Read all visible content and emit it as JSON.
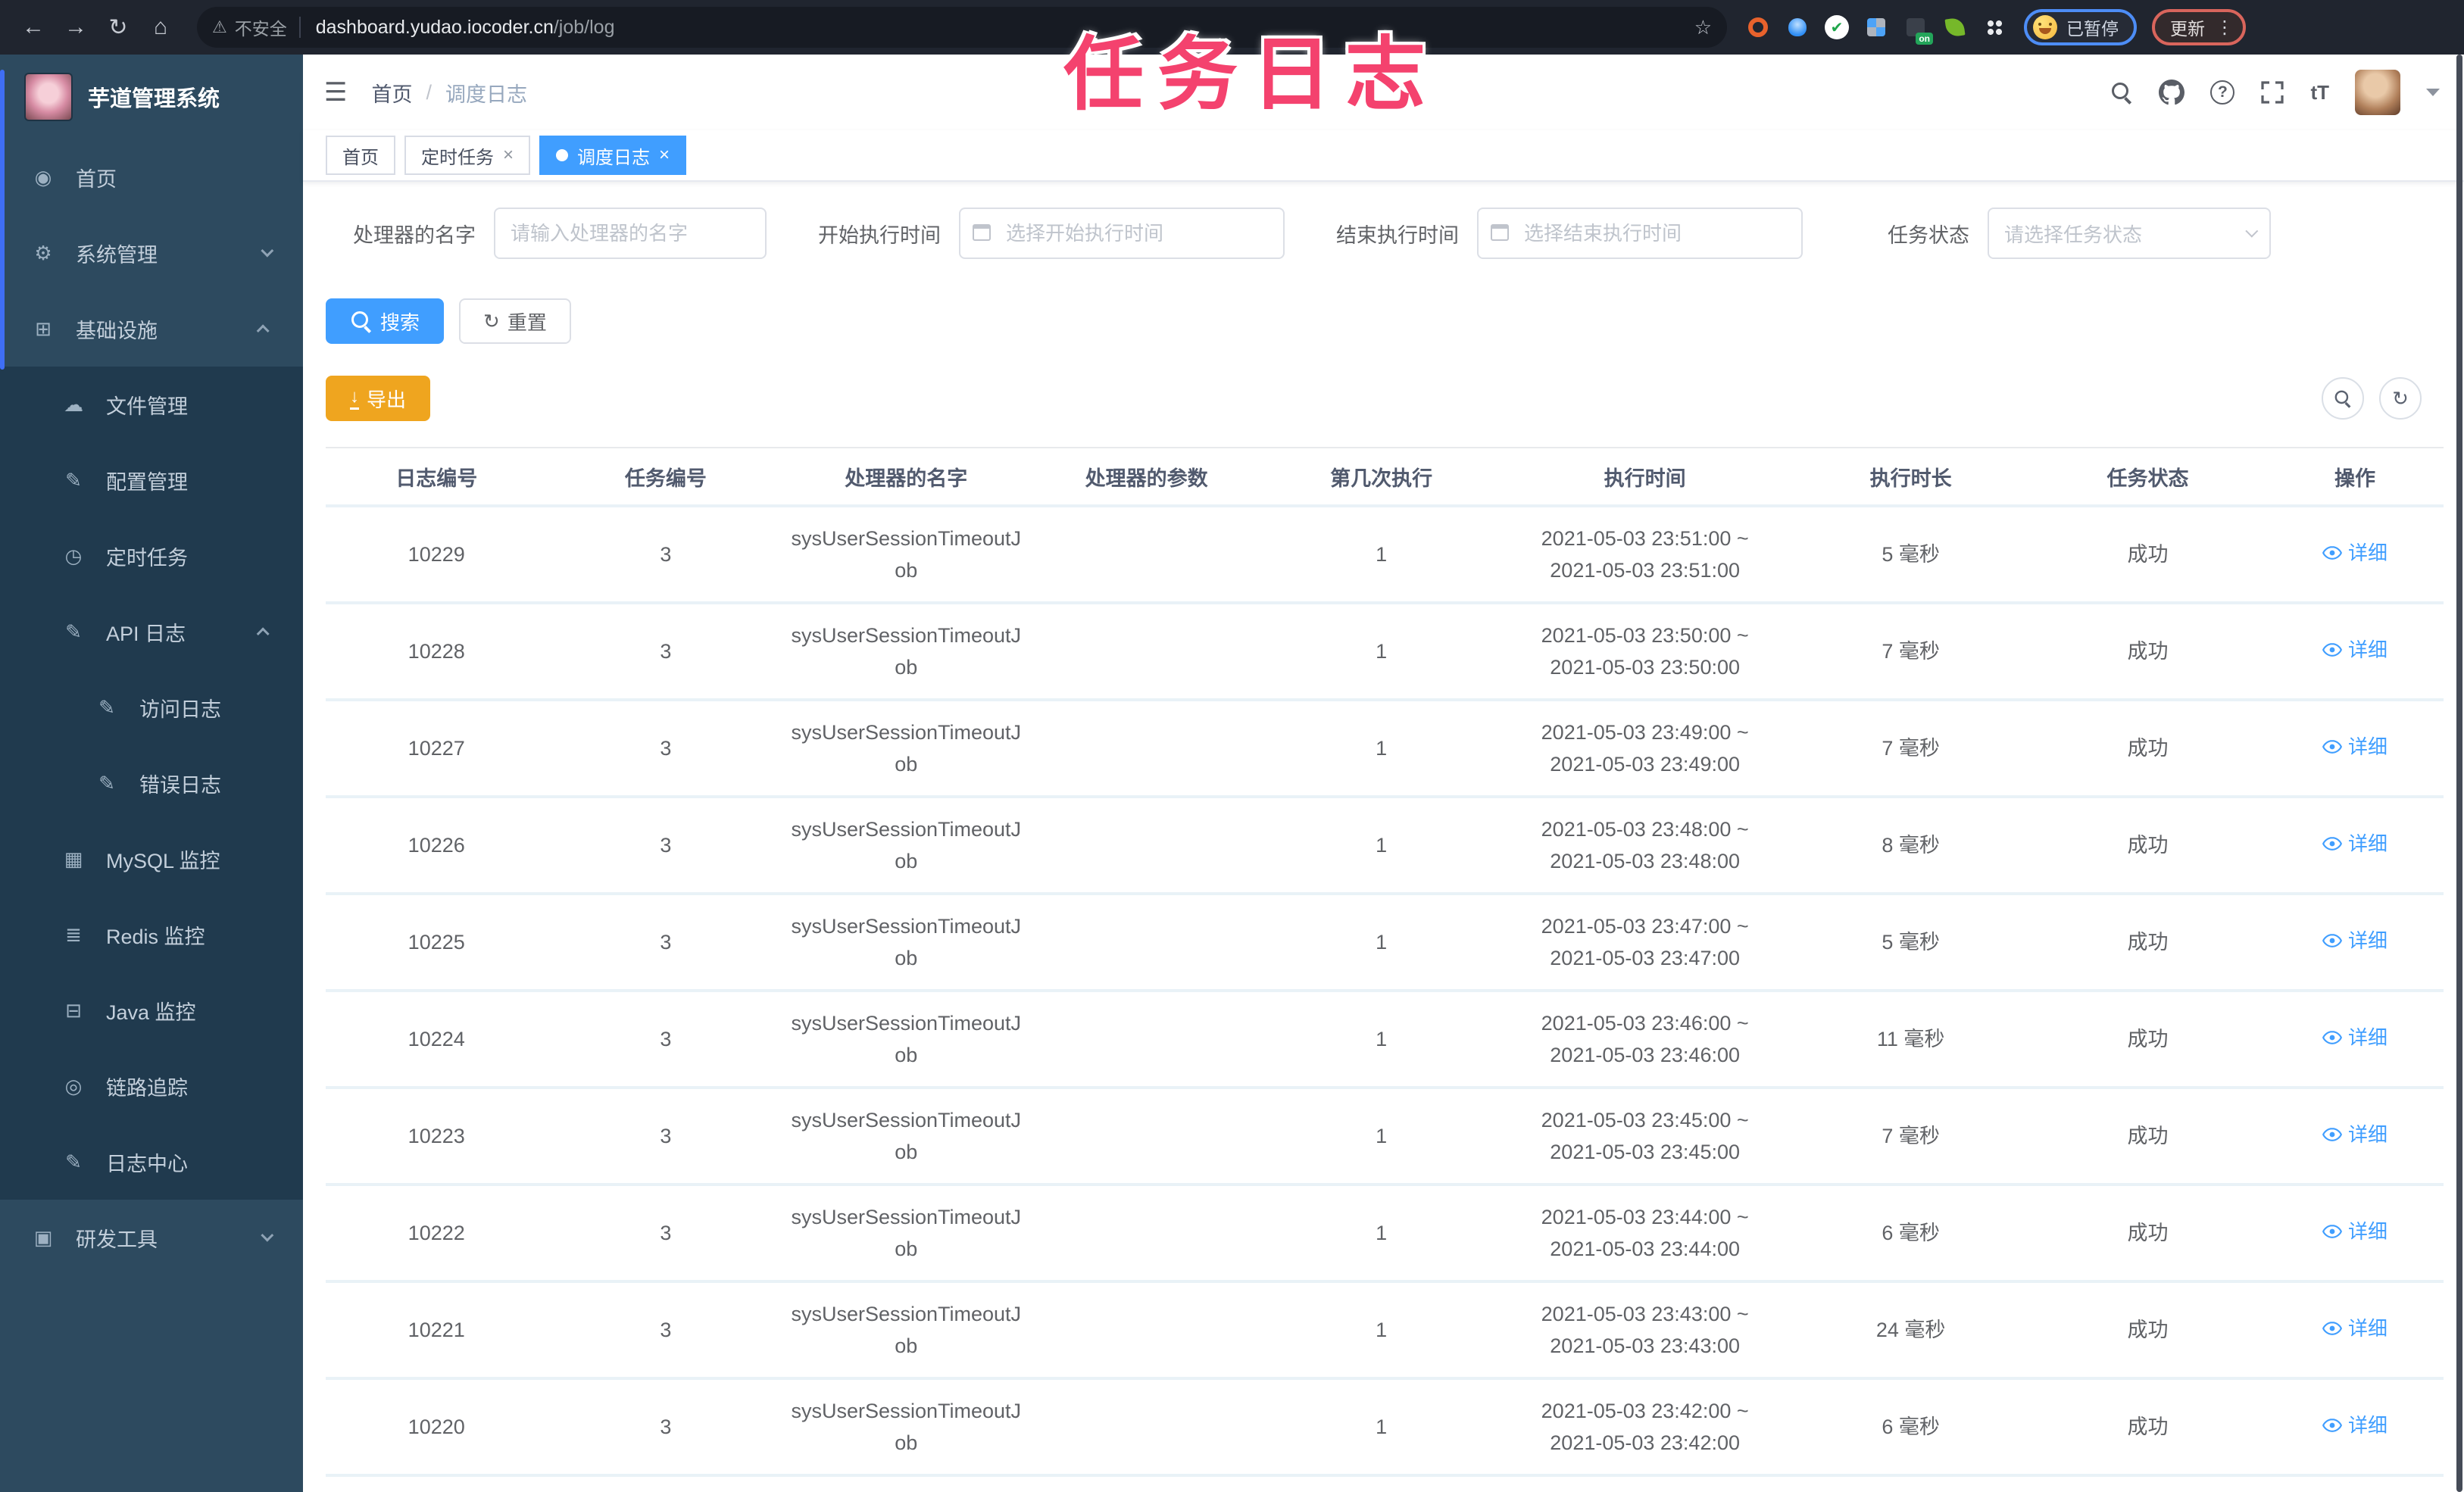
{
  "browser": {
    "security_label": "不安全",
    "url_host": "dashboard.yudao.iocoder.cn",
    "url_path": "/job/log",
    "bookmark_icon": "☆",
    "extension_on_badge": "on",
    "profile_chip_label": "已暂停",
    "profile_chip_emoji": "grinning-face",
    "update_chip_label": "更新"
  },
  "overlay": {
    "title": "任务日志"
  },
  "sidebar": {
    "app_title": "芋道管理系统",
    "menu": [
      {
        "label": "首页",
        "icon": "◉",
        "icon_name": "dashboard-icon",
        "level": "0",
        "chevron": ""
      },
      {
        "label": "系统管理",
        "icon": "⚙",
        "icon_name": "gear-icon",
        "level": "0",
        "chevron": "down"
      },
      {
        "label": "基础设施",
        "icon": "⊞",
        "icon_name": "infrastructure-icon",
        "level": "0",
        "chevron": "up"
      },
      {
        "label": "文件管理",
        "icon": "☁",
        "icon_name": "cloud-upload-icon",
        "level": "1",
        "chevron": ""
      },
      {
        "label": "配置管理",
        "icon": "✎",
        "icon_name": "edit-icon",
        "level": "1",
        "chevron": ""
      },
      {
        "label": "定时任务",
        "icon": "◷",
        "icon_name": "timer-icon",
        "level": "1",
        "chevron": ""
      },
      {
        "label": "API 日志",
        "icon": "✎",
        "icon_name": "api-log-icon",
        "level": "1",
        "chevron": "up"
      },
      {
        "label": "访问日志",
        "icon": "✎",
        "icon_name": "access-log-icon",
        "level": "2",
        "chevron": ""
      },
      {
        "label": "错误日志",
        "icon": "✎",
        "icon_name": "error-log-icon",
        "level": "2",
        "chevron": ""
      },
      {
        "label": "MySQL 监控",
        "icon": "▦",
        "icon_name": "mysql-monitor-icon",
        "level": "1",
        "chevron": ""
      },
      {
        "label": "Redis 监控",
        "icon": "≣",
        "icon_name": "redis-monitor-icon",
        "level": "1",
        "chevron": ""
      },
      {
        "label": "Java 监控",
        "icon": "⊟",
        "icon_name": "java-monitor-icon",
        "level": "1",
        "chevron": ""
      },
      {
        "label": "链路追踪",
        "icon": "◎",
        "icon_name": "trace-eye-icon",
        "level": "1",
        "chevron": ""
      },
      {
        "label": "日志中心",
        "icon": "✎",
        "icon_name": "log-center-icon",
        "level": "1",
        "chevron": ""
      },
      {
        "label": "研发工具",
        "icon": "▣",
        "icon_name": "toolbox-icon",
        "level": "0",
        "chevron": "down"
      }
    ]
  },
  "navbar": {
    "breadcrumb_root": "首页",
    "breadcrumb_separator": "/",
    "breadcrumb_current": "调度日志",
    "font_size_icon": "tT"
  },
  "tabs": [
    {
      "label": "首页"
    },
    {
      "label": "定时任务",
      "close": "×"
    },
    {
      "label": "调度日志",
      "close": "×"
    }
  ],
  "filters": {
    "handler": {
      "label": "处理器的名字",
      "placeholder": "请输入处理器的名字"
    },
    "begin_time": {
      "label": "开始执行时间",
      "placeholder": "选择开始执行时间"
    },
    "end_time": {
      "label": "结束执行时间",
      "placeholder": "选择结束执行时间"
    },
    "status": {
      "label": "任务状态",
      "placeholder": "请选择任务状态"
    }
  },
  "actions": {
    "search": "搜索",
    "reset": "重置",
    "export": "导出"
  },
  "colors": {
    "primary": "#409eff",
    "warning": "#efa51f",
    "annotation_pink": "#f4426e"
  },
  "table": {
    "columns": [
      "日志编号",
      "任务编号",
      "处理器的名字",
      "处理器的参数",
      "第几次执行",
      "执行时间",
      "执行时长",
      "任务状态",
      "操作"
    ],
    "rows": [
      {
        "log_id": "10229",
        "task_id": "3",
        "handler": "sysUserSessionTimeoutJob",
        "param": "",
        "exec_index": "1",
        "time_start": "2021-05-03 23:51:00 ~",
        "time_end": "2021-05-03 23:51:00",
        "duration": "5 毫秒",
        "status": "成功",
        "action": "详细"
      },
      {
        "log_id": "10228",
        "task_id": "3",
        "handler": "sysUserSessionTimeoutJob",
        "param": "",
        "exec_index": "1",
        "time_start": "2021-05-03 23:50:00 ~",
        "time_end": "2021-05-03 23:50:00",
        "duration": "7 毫秒",
        "status": "成功",
        "action": "详细"
      },
      {
        "log_id": "10227",
        "task_id": "3",
        "handler": "sysUserSessionTimeoutJob",
        "param": "",
        "exec_index": "1",
        "time_start": "2021-05-03 23:49:00 ~",
        "time_end": "2021-05-03 23:49:00",
        "duration": "7 毫秒",
        "status": "成功",
        "action": "详细"
      },
      {
        "log_id": "10226",
        "task_id": "3",
        "handler": "sysUserSessionTimeoutJob",
        "param": "",
        "exec_index": "1",
        "time_start": "2021-05-03 23:48:00 ~",
        "time_end": "2021-05-03 23:48:00",
        "duration": "8 毫秒",
        "status": "成功",
        "action": "详细"
      },
      {
        "log_id": "10225",
        "task_id": "3",
        "handler": "sysUserSessionTimeoutJob",
        "param": "",
        "exec_index": "1",
        "time_start": "2021-05-03 23:47:00 ~",
        "time_end": "2021-05-03 23:47:00",
        "duration": "5 毫秒",
        "status": "成功",
        "action": "详细"
      },
      {
        "log_id": "10224",
        "task_id": "3",
        "handler": "sysUserSessionTimeoutJob",
        "param": "",
        "exec_index": "1",
        "time_start": "2021-05-03 23:46:00 ~",
        "time_end": "2021-05-03 23:46:00",
        "duration": "11 毫秒",
        "status": "成功",
        "action": "详细"
      },
      {
        "log_id": "10223",
        "task_id": "3",
        "handler": "sysUserSessionTimeoutJob",
        "param": "",
        "exec_index": "1",
        "time_start": "2021-05-03 23:45:00 ~",
        "time_end": "2021-05-03 23:45:00",
        "duration": "7 毫秒",
        "status": "成功",
        "action": "详细"
      },
      {
        "log_id": "10222",
        "task_id": "3",
        "handler": "sysUserSessionTimeoutJob",
        "param": "",
        "exec_index": "1",
        "time_start": "2021-05-03 23:44:00 ~",
        "time_end": "2021-05-03 23:44:00",
        "duration": "6 毫秒",
        "status": "成功",
        "action": "详细"
      },
      {
        "log_id": "10221",
        "task_id": "3",
        "handler": "sysUserSessionTimeoutJob",
        "param": "",
        "exec_index": "1",
        "time_start": "2021-05-03 23:43:00 ~",
        "time_end": "2021-05-03 23:43:00",
        "duration": "24 毫秒",
        "status": "成功",
        "action": "详细"
      },
      {
        "log_id": "10220",
        "task_id": "3",
        "handler": "sysUserSessionTimeoutJob",
        "param": "",
        "exec_index": "1",
        "time_start": "2021-05-03 23:42:00 ~",
        "time_end": "2021-05-03 23:42:00",
        "duration": "6 毫秒",
        "status": "成功",
        "action": "详细"
      }
    ]
  }
}
